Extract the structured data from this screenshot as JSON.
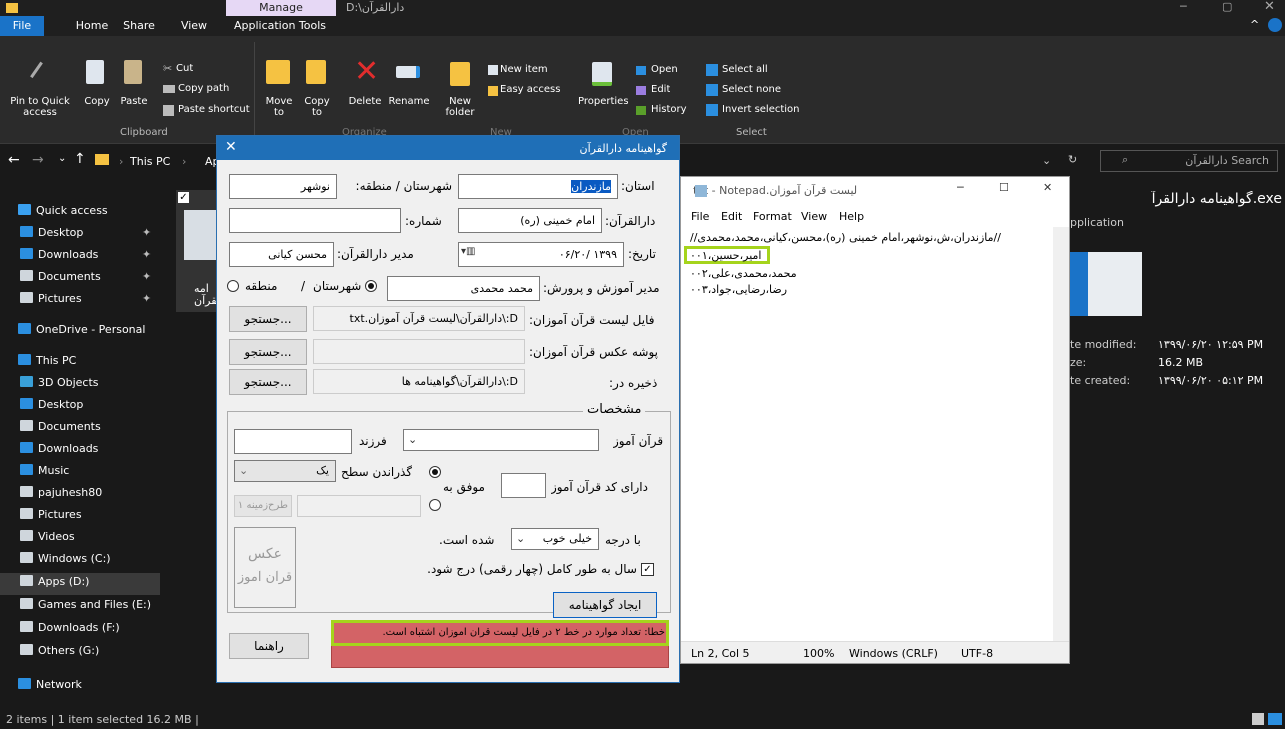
{
  "explorer": {
    "manage_tab": "Manage",
    "window_path": "D:\\دارالقرآن",
    "tabs": [
      "File",
      "Home",
      "Share",
      "View",
      "Application Tools"
    ],
    "ribbon": {
      "pin": "Pin to Quick access",
      "copy": "Copy",
      "paste": "Paste",
      "cut": "Cut",
      "copy_path": "Copy path",
      "paste_shortcut": "Paste shortcut",
      "move_to": "Move to",
      "copy_to": "Copy to",
      "delete": "Delete",
      "rename": "Rename",
      "new_folder": "New folder",
      "new_item": "New item",
      "easy_access": "Easy access",
      "properties": "Properties",
      "open": "Open",
      "edit": "Edit",
      "history": "History",
      "select_all": "Select all",
      "select_none": "Select none",
      "invert_selection": "Invert selection",
      "groups": {
        "clipboard": "Clipboard",
        "organize": "Organize",
        "new": "New",
        "open": "Open",
        "select": "Select"
      }
    },
    "breadcrumb": [
      "This PC",
      "Ap"
    ],
    "search_placeholder": "Search دارالقرآن",
    "nav": [
      {
        "label": "Quick access",
        "color": "#3aa0f0"
      },
      {
        "label": "Desktop",
        "color": "#2b8fe0"
      },
      {
        "label": "Downloads",
        "color": "#2b8fe0"
      },
      {
        "label": "Documents",
        "color": "#cfd6dc"
      },
      {
        "label": "Pictures",
        "color": "#cfd6dc"
      },
      {
        "label": "OneDrive - Personal",
        "color": "#2b8fe0"
      },
      {
        "label": "This PC",
        "color": "#2b8fe0"
      },
      {
        "label": "3D Objects",
        "color": "#39a0d8"
      },
      {
        "label": "Desktop",
        "color": "#2b8fe0"
      },
      {
        "label": "Documents",
        "color": "#cfd6dc"
      },
      {
        "label": "Downloads",
        "color": "#2b8fe0"
      },
      {
        "label": "Music",
        "color": "#2b8fe0"
      },
      {
        "label": "pajuhesh80",
        "color": "#cfd6dc"
      },
      {
        "label": "Pictures",
        "color": "#cfd6dc"
      },
      {
        "label": "Videos",
        "color": "#cfd6dc"
      },
      {
        "label": "Windows (C:)",
        "color": "#cfd6dc"
      },
      {
        "label": "Apps (D:)",
        "color": "#cfd6dc"
      },
      {
        "label": "Games and Files (E:)",
        "color": "#cfd6dc"
      },
      {
        "label": "Downloads (F:)",
        "color": "#cfd6dc"
      },
      {
        "label": "Others (G:)",
        "color": "#cfd6dc"
      },
      {
        "label": "Network",
        "color": "#2b8fe0"
      }
    ],
    "file_label_partial": [
      "امه",
      "لقرآن"
    ],
    "details": {
      "name": "exe.گواهینامه دارالقرآ",
      "type": "pplication",
      "date_modified_label": "te modified:",
      "date_modified": "۱۳۹۹/۰۶/۲۰ ۱۲:۵۹ PM",
      "size_label": "ze:",
      "size": "16.2 MB",
      "date_created_label": "te created:",
      "date_created": "۱۳۹۹/۰۶/۲۰ ۰۵:۱۲ PM"
    },
    "status": "2 items  |  1 item selected  16.2 MB  |"
  },
  "dialog": {
    "title": "گواهینامه دارالقرآن",
    "province_label": "استان:",
    "province": "مازندران",
    "city_label": "شهرستان / منطقه:",
    "city": "نوشهر",
    "darolquran_label": "دارالقرآن:",
    "darolquran": "امام خمینی (ره)",
    "number_label": "شماره:",
    "number": "",
    "date_label": "تاریخ:",
    "date": "۱۳۹۹ /۰۶/۲۰",
    "manager_label": "مدیر دارالقرآن:",
    "manager": "محسن کیانی",
    "edu_label": "مدیر آموزش و پرورش:",
    "edu": "محمد محمدی",
    "radio_city": "شهرستان",
    "radio_sep": "/",
    "radio_region": "منطقه",
    "list_label": "فایل لیست قرآن آموزان:",
    "list_path": "D:\\دارالقرآن\\لیست قرآن آموزان.txt",
    "photo_label": "پوشه عکس قرآن آموزان:",
    "photo_path": "",
    "save_label": "ذخیره در:",
    "save_path": "D:\\دارالقرآن\\گواهینامه ها",
    "browse": "جستجو...",
    "group_title": "مشخصات",
    "student_label": "قرآن آموز",
    "child_label": "فرزند",
    "passed_label": "گذراندن سطح",
    "level": "یک",
    "code_label": "دارای کد قرآن آموز",
    "success_label": "موفق به",
    "plan": "طرح‌زمینه ۱",
    "grade_prefix": "با درجه",
    "grade": "خیلی خوب",
    "grade_suffix": "شده است.",
    "photo_placeholder": [
      "عکس",
      "قرآن آموز"
    ],
    "full_year": "سال به طور کامل (چهار رقمی) درج شود.",
    "create": "ایجاد گواهینامه",
    "help": "راهنما",
    "error": "خطا: تعداد موارد در خط ۲ در فایل لیست قرآن آموزان اشتباه است."
  },
  "notepad": {
    "title": "لیست قرآن آموزان.txt - Notepad",
    "menu": [
      "File",
      "Edit",
      "Format",
      "View",
      "Help"
    ],
    "lines": [
      "//مازندران،ش،نوشهر،امام خمینی (ره)،محسن،کیانی،محمد،محمدی//",
      "امیر،حسین،۰۰۱",
      "محمد،محمدی،علی،۰۰۲",
      "رضا،رضایی،جواد،۰۰۳"
    ],
    "status": [
      "Ln 2, Col 5",
      "100%",
      "Windows (CRLF)",
      "UTF-8"
    ]
  },
  "colors": {
    "highlight": "#a5d41c",
    "error_bg": "#d36366",
    "title_blue": "#1f6fb7"
  }
}
